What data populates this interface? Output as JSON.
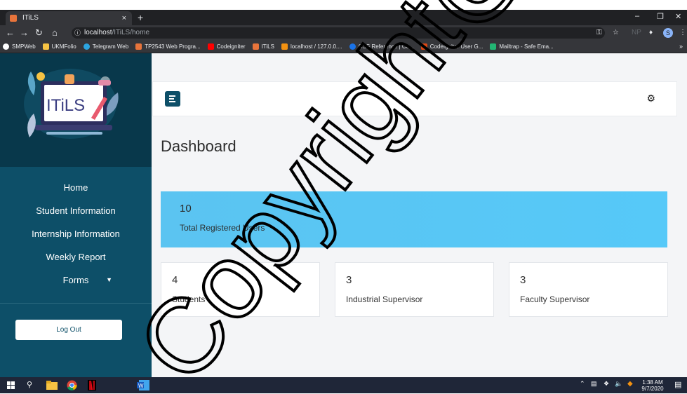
{
  "browser": {
    "tab_title": "ITiLS",
    "tab_close": "×",
    "new_tab": "+",
    "url_host": "localhost",
    "url_path": "/ITiLS/home",
    "profile_initial": "S",
    "extension_label": "NP",
    "bookmarks": [
      {
        "label": "SMPWeb",
        "color": "#ffffff"
      },
      {
        "label": "UKMFolio",
        "color": "#f6c343"
      },
      {
        "label": "Telegram Web",
        "color": "#2ca5e0"
      },
      {
        "label": "TP2543 Web Progra...",
        "color": "#e8743b"
      },
      {
        "label": "Codeigniter",
        "color": "#ff0000"
      },
      {
        "label": "ITiLS",
        "color": "#e8743b"
      },
      {
        "label": "localhost / 127.0.0....",
        "color": "#f29111"
      },
      {
        "label": "CSS Reference | Co...",
        "color": "#1a73e8"
      },
      {
        "label": "CodeIgniter User G...",
        "color": "#dd4814"
      },
      {
        "label": "Mailtrap - Safe Ema...",
        "color": "#22b573"
      }
    ],
    "bookmarks_more": "»"
  },
  "sidebar": {
    "logo_text": "ITiLS",
    "items": [
      {
        "label": "Home"
      },
      {
        "label": "Student Information"
      },
      {
        "label": "Internship Information"
      },
      {
        "label": "Weekly Report"
      },
      {
        "label": "Forms"
      }
    ],
    "logout_label": "Log Out"
  },
  "main": {
    "title": "Dashboard",
    "total": {
      "value": "10",
      "label": "Total Registered Users"
    },
    "cards": [
      {
        "value": "4",
        "label": "Students"
      },
      {
        "value": "3",
        "label": "Industrial Supervisor"
      },
      {
        "value": "3",
        "label": "Faculty Supervisor"
      }
    ]
  },
  "taskbar": {
    "time": "1:38 AM",
    "date": "9/7/2020"
  },
  "watermark": {
    "text": "Copyright@FTSM"
  },
  "colors": {
    "sidebar": "#0d4f68",
    "accent": "#56c9f8"
  }
}
